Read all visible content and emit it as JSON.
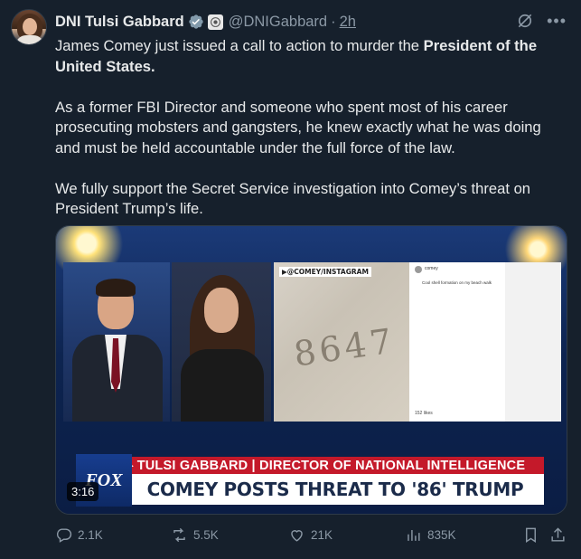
{
  "header": {
    "display_name": "DNI Tulsi Gabbard",
    "handle": "@DNIGabbard",
    "separator": "·",
    "time_ago": "2h"
  },
  "tweet": {
    "para1_prefix": "James Comey just issued a call to action to murder the ",
    "para1_bold": "President of the United States.",
    "para2": "As a former FBI Director and someone who spent most of his career prosecuting mobsters and gangsters, he knew exactly what he was doing and must be held accountable under the full force of the law.",
    "para3": "We fully support the Secret Service investigation into Comey’s threat on President Trump’s life."
  },
  "media": {
    "instagram_label": "▶@COMEY/INSTAGRAM",
    "shells_text": "8647",
    "ig_username": "comey",
    "ig_caption": "Cool shell formation on my beach walk",
    "ig_likes": "152 likes",
    "chyron_top": "▸ TULSI GABBARD | DIRECTOR OF NATIONAL INTELLIGENCE",
    "chyron_main": "COMEY POSTS THREAT TO '86' TRUMP",
    "network_logo": "FOX",
    "duration": "3:16"
  },
  "actions": {
    "replies": "2.1K",
    "reposts": "5.5K",
    "likes": "21K",
    "views": "835K"
  },
  "colors": {
    "background": "#16202c",
    "text": "#e7e9ea",
    "muted": "#8b98a5",
    "verified_badge": "#829aab",
    "chyron_red": "#c4192a"
  },
  "icons": [
    "verified-badge-icon",
    "affiliate-badge-icon",
    "grok-icon",
    "more-icon",
    "reply-icon",
    "repost-icon",
    "like-icon",
    "views-icon",
    "bookmark-icon",
    "share-icon"
  ]
}
